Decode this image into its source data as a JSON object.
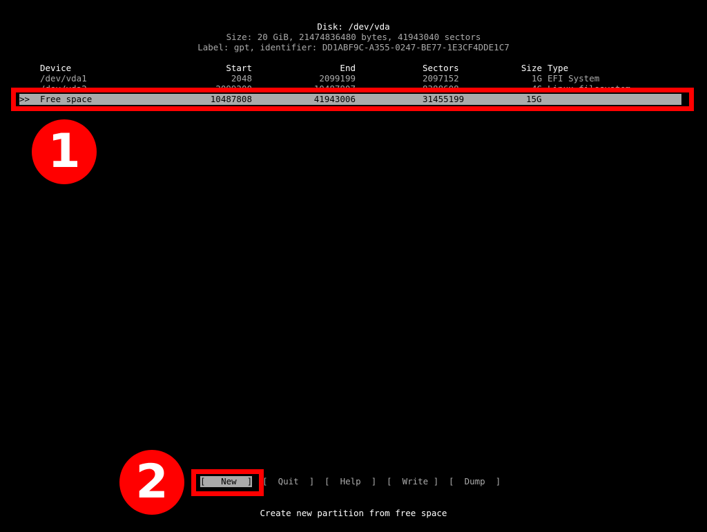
{
  "header": {
    "title": "Disk: /dev/vda",
    "size_line": "Size: 20 GiB, 21474836480 bytes, 41943040 sectors",
    "label_line": "Label: gpt, identifier: DD1ABF9C-A355-0247-BE77-1E3CF4DDE1C7"
  },
  "table": {
    "columns": {
      "device": "Device",
      "start": "Start",
      "end": "End",
      "sectors": "Sectors",
      "size": "Size",
      "type": "Type"
    },
    "rows": [
      {
        "device": "/dev/vda1",
        "start": "2048",
        "end": "2099199",
        "sectors": "2097152",
        "size": "1G",
        "type": "EFI System"
      },
      {
        "device": "/dev/vda2",
        "start": "2099200",
        "end": "10487807",
        "sectors": "8388608",
        "size": "4G",
        "type": "Linux filesystem"
      }
    ],
    "selected": {
      "marker": ">>",
      "device": "Free space",
      "start": "10487808",
      "end": "41943006",
      "sectors": "31455199",
      "size": "15G",
      "type": ""
    }
  },
  "menu": {
    "buttons": [
      {
        "label": "[   New  ]",
        "selected": true
      },
      {
        "label": "[  Quit  ]",
        "selected": false
      },
      {
        "label": "[  Help  ]",
        "selected": false
      },
      {
        "label": "[  Write ]",
        "selected": false
      },
      {
        "label": "[  Dump  ]",
        "selected": false
      }
    ],
    "hint": "Create new partition from free space"
  },
  "annotations": {
    "badge1": "1",
    "badge2": "2",
    "color": "#ff0000"
  }
}
